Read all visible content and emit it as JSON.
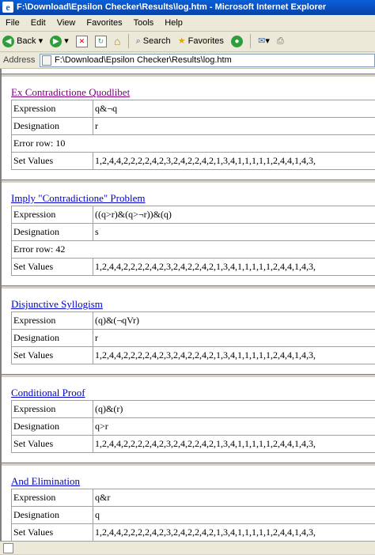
{
  "window": {
    "title": "F:\\Download\\Epsilon Checker\\Results\\log.htm - Microsoft Internet Explorer"
  },
  "menu": {
    "items": [
      "File",
      "Edit",
      "View",
      "Favorites",
      "Tools",
      "Help"
    ]
  },
  "toolbar": {
    "back_label": "Back",
    "search_label": "Search",
    "favorites_label": "Favorites"
  },
  "address": {
    "label": "Address",
    "value": "F:\\Download\\Epsilon Checker\\Results\\log.htm"
  },
  "colors": {
    "visited_link": "#800080",
    "link": "#0000cc",
    "titlebar": "#0842a8"
  },
  "sections": [
    {
      "title": "Ex Contradictione Quodlibet",
      "visited": true,
      "rows": [
        {
          "key": "Expression",
          "value": "q&¬q"
        },
        {
          "key": "Designation",
          "value": "r"
        },
        {
          "key": "Error row: 10",
          "value": ""
        },
        {
          "key": "Set Values",
          "value": "1,2,4,4,2,2,2,2,4,2,3,2,4,2,2,4,2,1,3,4,1,1,1,1,1,2,4,4,1,4,3,"
        }
      ]
    },
    {
      "title": "Imply \"Contradictione\" Problem",
      "visited": false,
      "rows": [
        {
          "key": "Expression",
          "value": "((q>r)&(q>¬r))&(q)"
        },
        {
          "key": "Designation",
          "value": "s"
        },
        {
          "key": "Error row: 42",
          "value": ""
        },
        {
          "key": "Set Values",
          "value": "1,2,4,4,2,2,2,2,4,2,3,2,4,2,2,4,2,1,3,4,1,1,1,1,1,2,4,4,1,4,3,"
        }
      ]
    },
    {
      "title": "Disjunctive Syllogism",
      "visited": false,
      "rows": [
        {
          "key": "Expression",
          "value": "(q)&(¬qVr)"
        },
        {
          "key": "Designation",
          "value": "r"
        },
        {
          "key": "Set Values",
          "value": "1,2,4,4,2,2,2,2,4,2,3,2,4,2,2,4,2,1,3,4,1,1,1,1,1,2,4,4,1,4,3,"
        }
      ]
    },
    {
      "title": "Conditional Proof",
      "visited": false,
      "rows": [
        {
          "key": "Expression",
          "value": "(q)&(r)"
        },
        {
          "key": "Designation",
          "value": "q>r"
        },
        {
          "key": "Set Values",
          "value": "1,2,4,4,2,2,2,2,4,2,3,2,4,2,2,4,2,1,3,4,1,1,1,1,1,2,4,4,1,4,3,"
        }
      ]
    },
    {
      "title": "And Elimination",
      "visited": false,
      "rows": [
        {
          "key": "Expression",
          "value": "q&r"
        },
        {
          "key": "Designation",
          "value": "q"
        },
        {
          "key": "Set Values",
          "value": "1,2,4,4,2,2,2,2,4,2,3,2,4,2,2,4,2,1,3,4,1,1,1,1,1,2,4,4,1,4,3,"
        }
      ]
    }
  ]
}
